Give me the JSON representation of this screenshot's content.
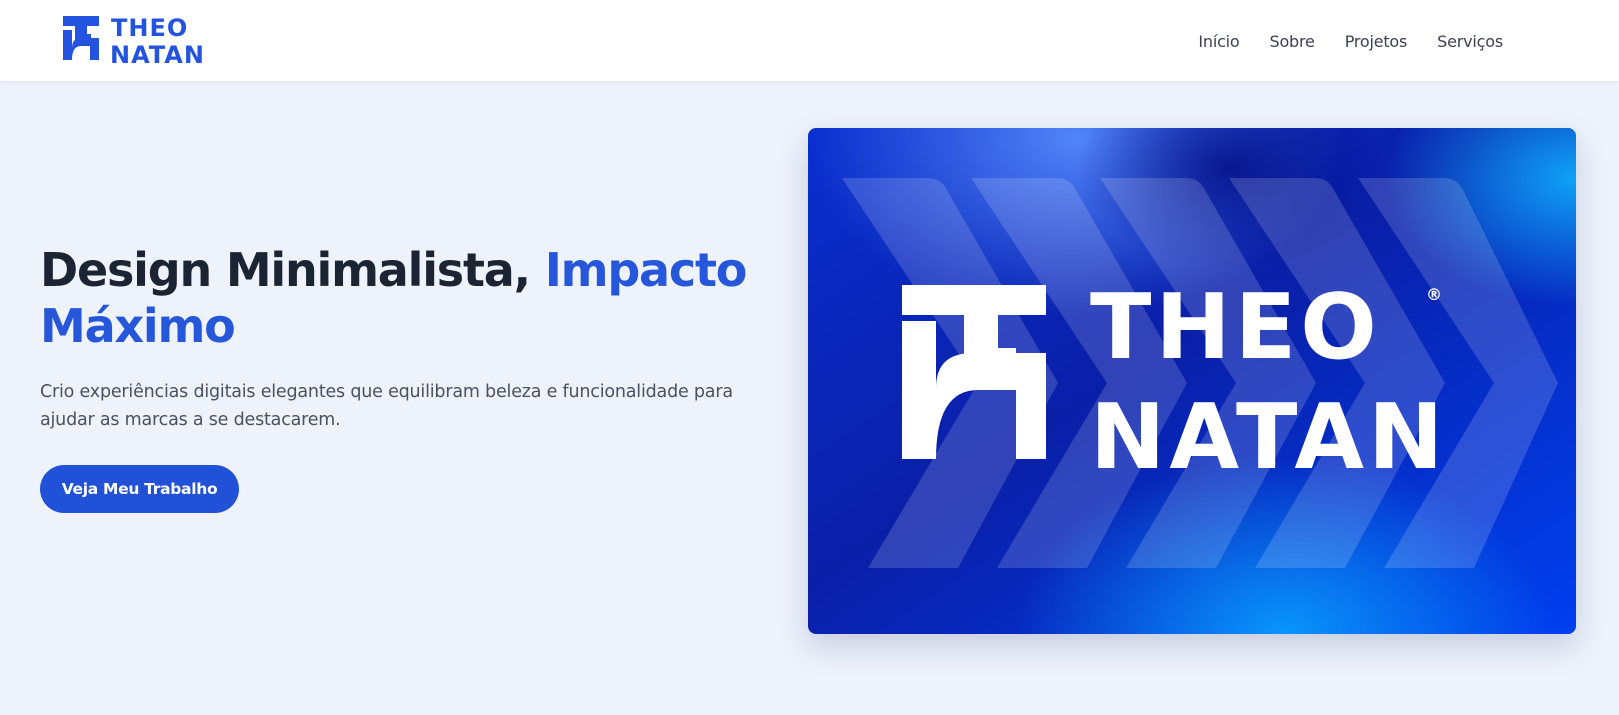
{
  "header": {
    "logo": {
      "line1": "THEO",
      "line2": "NATAN",
      "icon": "tn-monogram-icon"
    },
    "nav": [
      {
        "label": "Início"
      },
      {
        "label": "Sobre"
      },
      {
        "label": "Projetos"
      },
      {
        "label": "Serviços"
      }
    ]
  },
  "hero": {
    "headline_part1": "Design Minimalista, ",
    "headline_part2": "Impacto Máximo",
    "subtitle": "Crio experiências digitais elegantes que equilibram beleza e funcionalidade para ajudar as marcas a se destacarem.",
    "cta_label": "Veja Meu Trabalho",
    "image": {
      "line1": "THEO",
      "line2": "NATAN",
      "registered": "®"
    }
  },
  "colors": {
    "accent": "#2656d9",
    "button": "#2151d6",
    "text_dark": "#1c2433",
    "background": "#edf2fb"
  }
}
